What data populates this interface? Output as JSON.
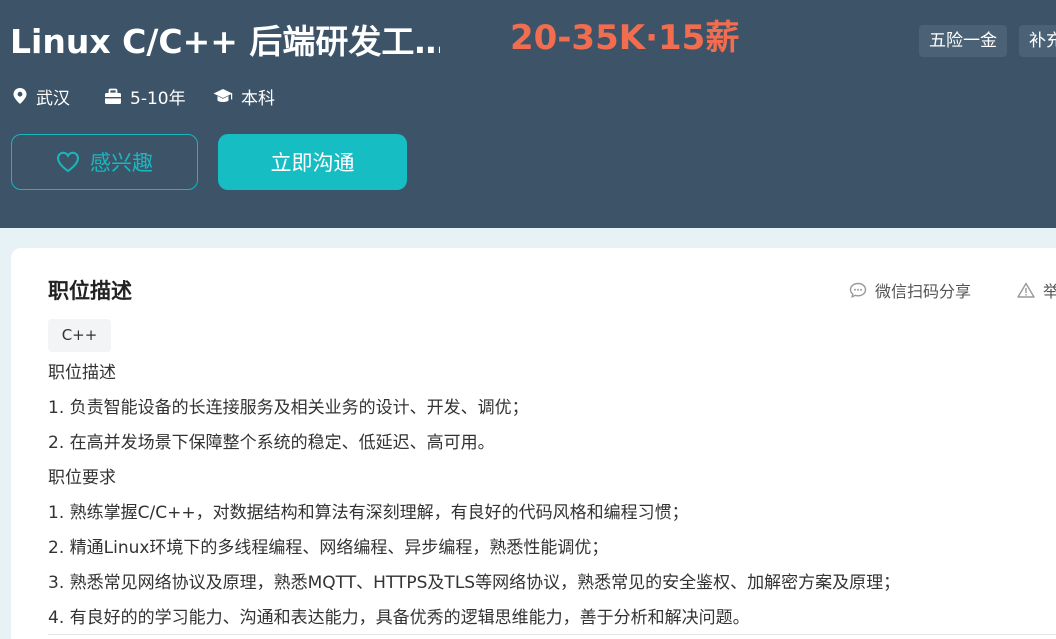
{
  "job": {
    "title": "Linux C/C++ 后端研发工…",
    "salary": "20-35K·15薪",
    "tags": [
      "五险一金",
      "补充"
    ],
    "location": "武汉",
    "experience": "5-10年",
    "education": "本科"
  },
  "actions": {
    "interest_label": "感兴趣",
    "chat_label": "立即沟通"
  },
  "description": {
    "section_title": "职位描述",
    "share_label": "微信扫码分享",
    "report_label": "举",
    "skill_tag": "C++",
    "lines": [
      "职位描述",
      "1. 负责智能设备的长连接服务及相关业务的设计、开发、调优；",
      "2. 在高并发场景下保障整个系统的稳定、低延迟、高可用。",
      "职位要求",
      "1. 熟练掌握C/C++，对数据结构和算法有深刻理解，有良好的代码风格和编程习惯；",
      "2. 精通Linux环境下的多线程编程、网络编程、异步编程，熟悉性能调优；",
      "3. 熟悉常见网络协议及原理，熟悉MQTT、HTTPS及TLS等网络协议，熟悉常见的安全鉴权、加解密方案及原理；",
      "4. 有良好的的学习能力、沟通和表达能力，具备优秀的逻辑思维能力，善于分析和解决问题。"
    ]
  },
  "colors": {
    "header_bg": "#3d5468",
    "salary": "#f26d4f",
    "accent": "#16bec3",
    "page_bg": "#e7f2f6"
  }
}
